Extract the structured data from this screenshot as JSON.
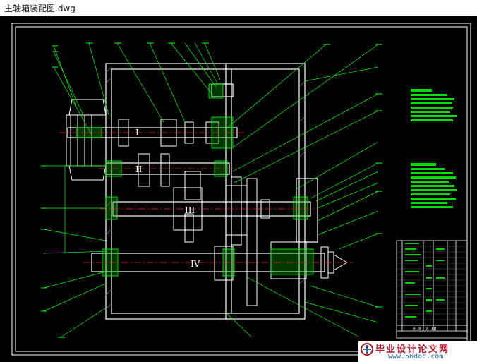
{
  "window": {
    "title": "主轴箱装配图.dwg"
  },
  "drawing": {
    "shaft_labels": [
      "I",
      "II",
      "III",
      "IV"
    ],
    "title_block_label": "F.0.18.AD",
    "colors": {
      "background": "#000000",
      "outline": "#ffffff",
      "leader": "#00ff00",
      "hatch": "#00ff00",
      "centerline": "#ff2020",
      "frame": "#ffffff"
    }
  },
  "watermark": {
    "text": "毕业设计论文网",
    "url": "www.56doc.com"
  }
}
